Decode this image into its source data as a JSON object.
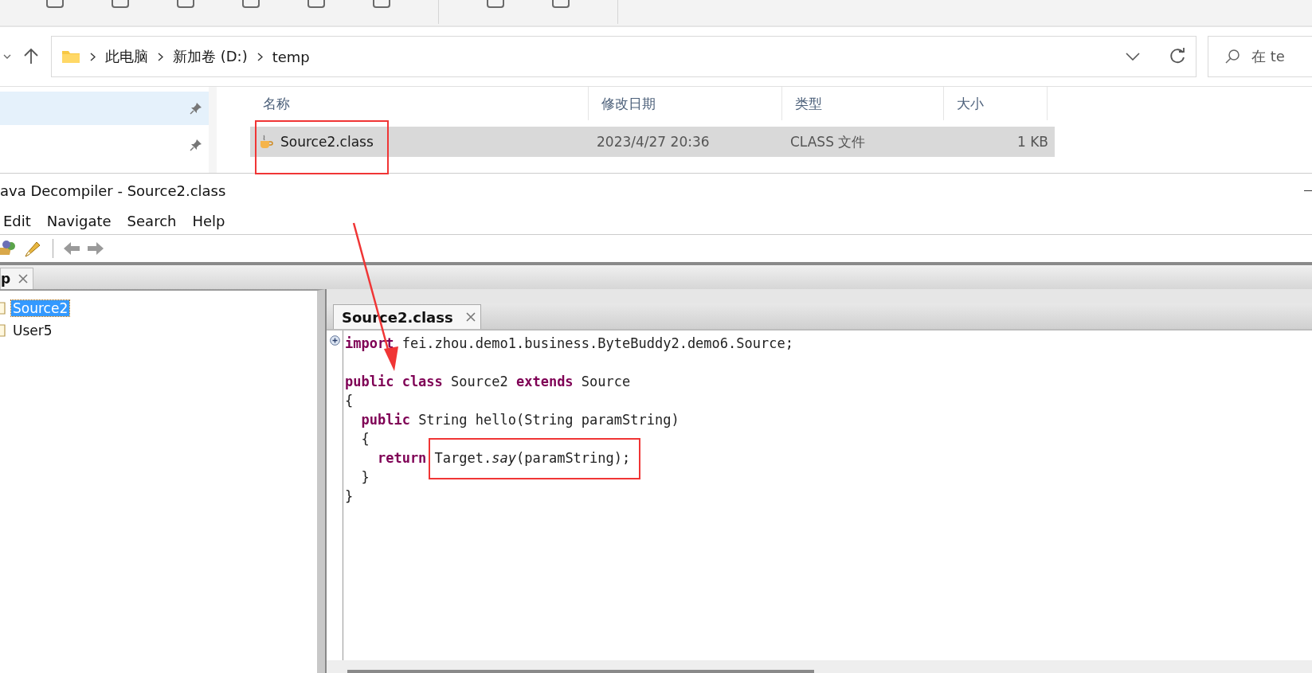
{
  "address_bar": {
    "breadcrumbs": [
      "此电脑",
      "新加卷 (D:)",
      "temp"
    ],
    "search_placeholder": "在 te"
  },
  "nav_items": [
    {
      "selected": true
    },
    {
      "selected": false
    }
  ],
  "file_list": {
    "columns": [
      "名称",
      "修改日期",
      "类型",
      "大小"
    ],
    "rows": [
      {
        "name": "Source2.class",
        "date": "2023/4/27 20:36",
        "type": "CLASS 文件",
        "size": "1 KB",
        "selected": true
      }
    ]
  },
  "decompiler": {
    "title": "ava Decompiler - Source2.class",
    "menu": [
      "Edit",
      "Navigate",
      "Search",
      "Help"
    ],
    "left_tab": "p",
    "tree": [
      {
        "label": "Source2",
        "selected": true
      },
      {
        "label": "User5",
        "selected": false
      }
    ],
    "editor_tab": "Source2.class",
    "code_lines": [
      {
        "gap_before": false,
        "tokens": [
          {
            "kind": "kw",
            "t": "import"
          },
          {
            "kind": "plain",
            "t": " fei.zhou.demo1.business.ByteBuddy2.demo6.Source;"
          }
        ]
      },
      {
        "gap_before": true,
        "tokens": [
          {
            "kind": "kw",
            "t": "public class"
          },
          {
            "kind": "plain",
            "t": " Source2 "
          },
          {
            "kind": "kw",
            "t": "extends"
          },
          {
            "kind": "plain",
            "t": " Source"
          }
        ]
      },
      {
        "gap_before": false,
        "tokens": [
          {
            "kind": "plain",
            "t": "{"
          }
        ]
      },
      {
        "gap_before": false,
        "tokens": [
          {
            "kind": "kw",
            "t": "  public"
          },
          {
            "kind": "plain",
            "t": " String hello(String paramString)"
          }
        ]
      },
      {
        "gap_before": false,
        "tokens": [
          {
            "kind": "plain",
            "t": "  {"
          }
        ]
      },
      {
        "gap_before": false,
        "tokens": [
          {
            "kind": "kw",
            "t": "    return"
          },
          {
            "kind": "plain",
            "t": " Target."
          },
          {
            "kind": "italic",
            "t": "say"
          },
          {
            "kind": "plain",
            "t": "(paramString);"
          }
        ]
      },
      {
        "gap_before": false,
        "tokens": [
          {
            "kind": "plain",
            "t": "  }"
          }
        ]
      },
      {
        "gap_before": false,
        "tokens": [
          {
            "kind": "plain",
            "t": "}"
          }
        ]
      }
    ]
  }
}
